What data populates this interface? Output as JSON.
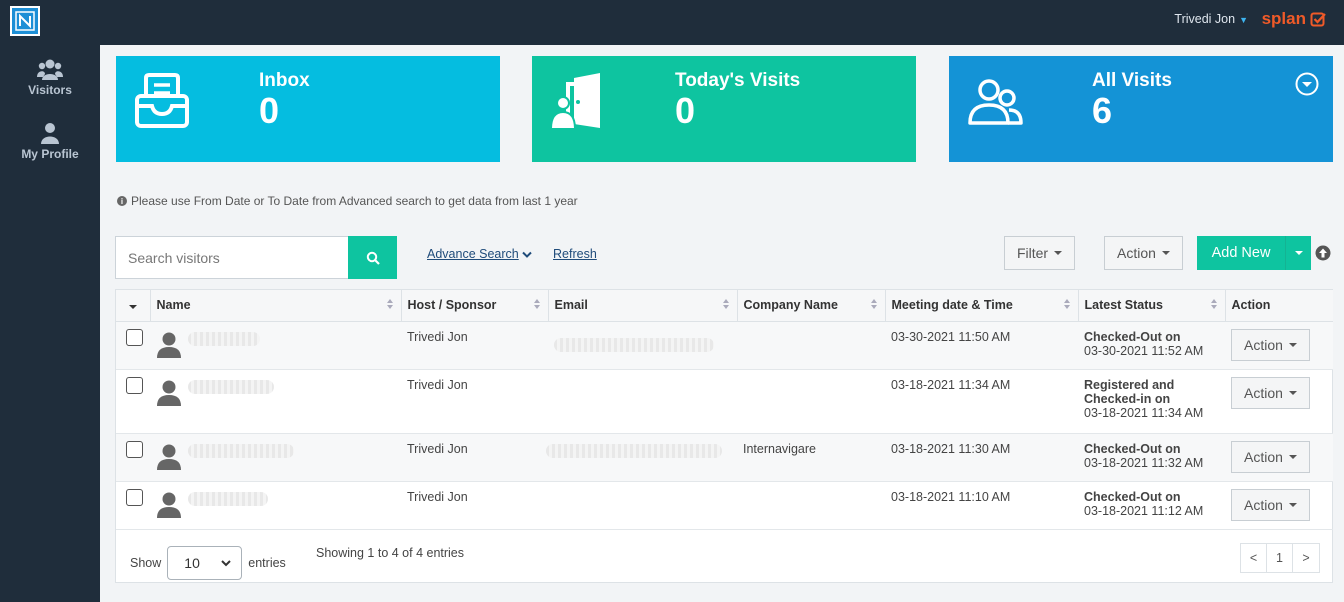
{
  "header": {
    "user_name": "Trivedi Jon",
    "brand": "splan"
  },
  "sidebar": {
    "items": [
      {
        "label": "Visitors",
        "icon": "users-icon"
      },
      {
        "label": "My Profile",
        "icon": "user-icon"
      }
    ]
  },
  "cards": {
    "inbox": {
      "label": "Inbox",
      "count": "0",
      "icon": "inbox-icon",
      "color": "#05bde0"
    },
    "today": {
      "label": "Today's Visits",
      "count": "0",
      "icon": "door-visitor-icon",
      "color": "#0ec4a0"
    },
    "all": {
      "label": "All Visits",
      "count": "6",
      "icon": "people-icon",
      "color": "#1493d6"
    }
  },
  "note": "Please use From Date or To Date from Advanced search to get data from last 1 year",
  "search": {
    "placeholder": "Search visitors"
  },
  "links": {
    "advance": "Advance Search",
    "refresh": "Refresh"
  },
  "toolbar": {
    "filter": "Filter",
    "action": "Action",
    "add_new": "Add New"
  },
  "table": {
    "columns": [
      "Name",
      "Host / Sponsor",
      "Email",
      "Company Name",
      "Meeting date & Time",
      "Latest Status",
      "Action"
    ],
    "rows": [
      {
        "host": "Trivedi Jon",
        "company": "",
        "meeting": "03-30-2021 11:50 AM",
        "status_label": "Checked-Out on",
        "status_date": "03-30-2021 11:52 AM",
        "action": "Action"
      },
      {
        "host": "Trivedi Jon",
        "company": "",
        "meeting": "03-18-2021 11:34 AM",
        "status_label": "Registered and Checked-in on",
        "status_date": "03-18-2021 11:34 AM",
        "action": "Action"
      },
      {
        "host": "Trivedi Jon",
        "company": "Internavigare",
        "meeting": "03-18-2021 11:30 AM",
        "status_label": "Checked-Out on",
        "status_date": "03-18-2021 11:32 AM",
        "action": "Action"
      },
      {
        "host": "Trivedi Jon",
        "company": "",
        "meeting": "03-18-2021 11:10 AM",
        "status_label": "Checked-Out on",
        "status_date": "03-18-2021 11:12 AM",
        "action": "Action"
      }
    ]
  },
  "footer": {
    "show": "Show",
    "page_length": "10",
    "entries": "entries",
    "showing": "Showing 1 to 4 of 4 entries",
    "prev": "<",
    "page": "1",
    "next": ">"
  }
}
